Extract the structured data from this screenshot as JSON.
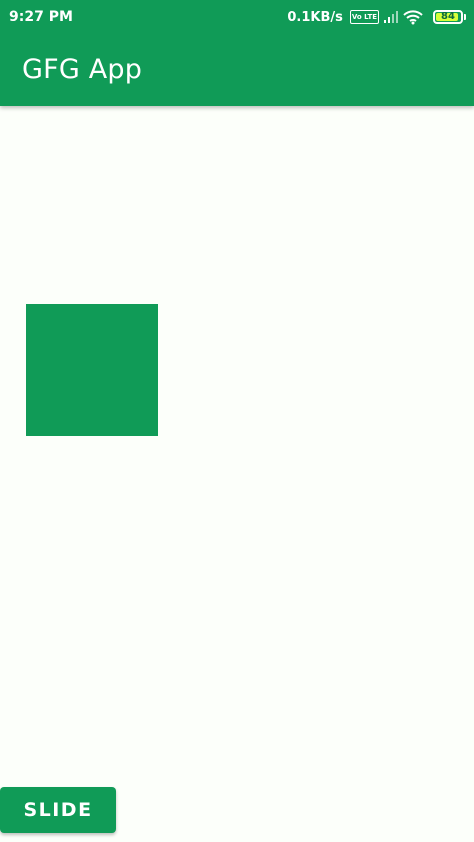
{
  "status_bar": {
    "time": "9:27 PM",
    "network_speed": "0.1KB/s",
    "volte_label": "Vo LTE",
    "battery_level": "84",
    "icons": [
      "volte-icon",
      "signal-icon",
      "wifi-icon",
      "battery-icon"
    ]
  },
  "app_bar": {
    "title": "GFG App"
  },
  "main": {
    "button_label": "SLIDE"
  },
  "colors": {
    "primary": "#109b57",
    "background": "#fcfffa",
    "battery_fill": "#d6ff3a"
  }
}
